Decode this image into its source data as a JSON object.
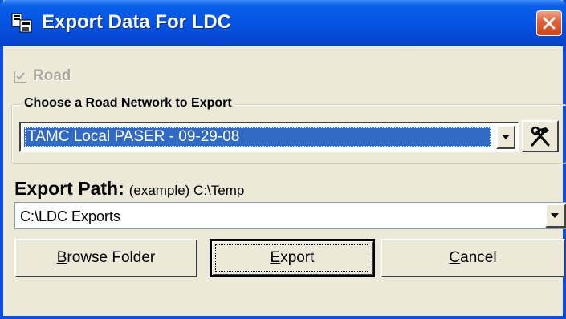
{
  "window": {
    "title": "Export Data For LDC"
  },
  "road_checkbox": {
    "label": "Road",
    "checked": true,
    "enabled": false
  },
  "network_group": {
    "legend": "Choose a Road Network to Export",
    "selected_network": "TAMC Local PASER - 09-29-08"
  },
  "export_path": {
    "label": "Export Path:",
    "example": "(example) C:\\Temp",
    "value": "C:\\LDC Exports"
  },
  "buttons": {
    "browse_mnemonic": "B",
    "browse_rest": "rowse Folder",
    "export_mnemonic": "E",
    "export_rest": "xport",
    "cancel_mnemonic": "C",
    "cancel_rest": "ancel"
  },
  "icons": {
    "app": "export-app-icon",
    "close": "close-icon",
    "dropdown": "chevron-down-icon",
    "tools": "hammer-wrench-icon"
  },
  "colors": {
    "titlebar": "#0554e2",
    "selection": "#316ac5",
    "close_button": "#e2643c",
    "face": "#ece9d8"
  }
}
